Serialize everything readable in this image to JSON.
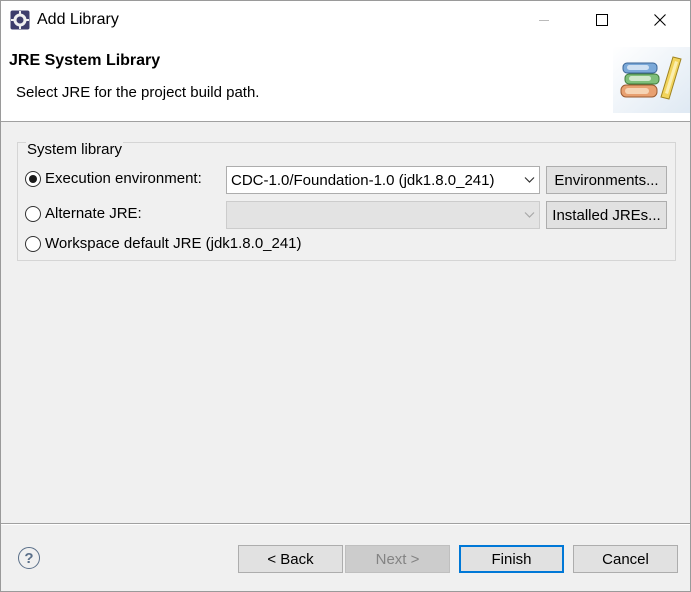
{
  "window": {
    "title": "Add Library",
    "icon": "eclipse-gear-icon"
  },
  "banner": {
    "title": "JRE System Library",
    "description": "Select JRE for the project build path.",
    "image": "books-icon"
  },
  "group": {
    "label": "System library",
    "options": [
      {
        "label": "Execution environment:",
        "checked": true
      },
      {
        "label": "Alternate JRE:",
        "checked": false
      },
      {
        "label": "Workspace default JRE (jdk1.8.0_241)",
        "checked": false
      }
    ],
    "execution_env_value": "CDC-1.0/Foundation-1.0 (jdk1.8.0_241)",
    "alternate_jre_value": "",
    "environments_button": "Environments...",
    "installed_jres_button": "Installed JREs..."
  },
  "footer": {
    "back": "< Back",
    "next": "Next >",
    "finish": "Finish",
    "cancel": "Cancel",
    "help": "?"
  },
  "colors": {
    "accent": "#0078d7",
    "dialog_bg": "#f0f0f0"
  }
}
